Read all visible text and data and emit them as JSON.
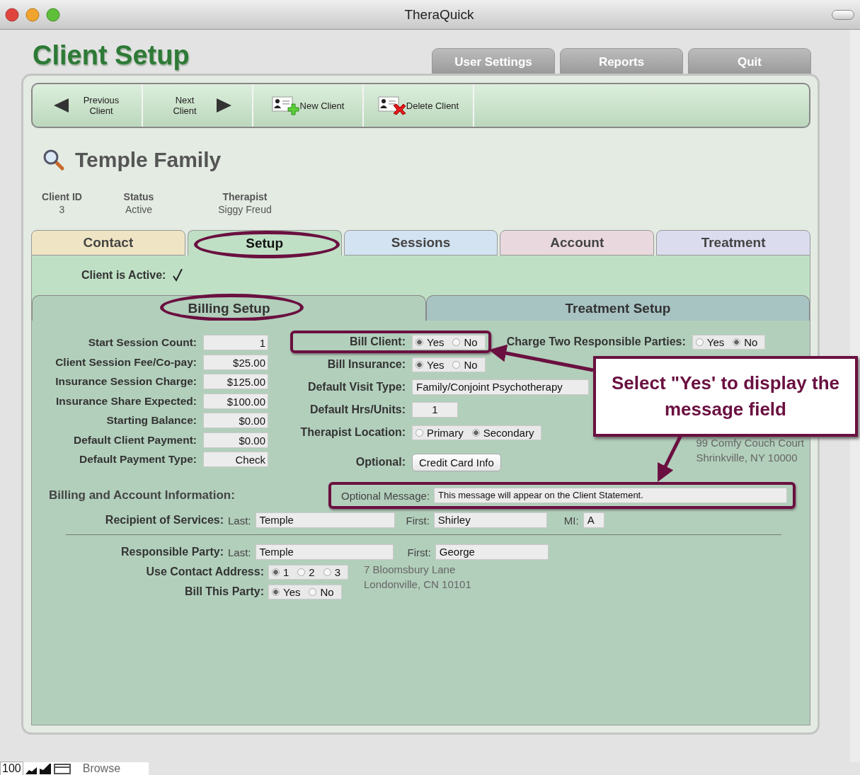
{
  "window": {
    "title": "TheraQuick"
  },
  "page_title": "Client Setup",
  "top_tabs": [
    {
      "label": "User Settings"
    },
    {
      "label": "Reports"
    },
    {
      "label": "Quit"
    }
  ],
  "toolbar": [
    {
      "kind": "prev",
      "label": "Previous Client"
    },
    {
      "kind": "next",
      "label": "Next Client"
    },
    {
      "kind": "new",
      "label": "New Client"
    },
    {
      "kind": "delete",
      "label": "Delete Client"
    }
  ],
  "client": {
    "name": "Temple Family",
    "fields": [
      {
        "label": "Client ID",
        "value": "3"
      },
      {
        "label": "Status",
        "value": "Active"
      },
      {
        "label": "Therapist",
        "value": "Siggy Freud"
      }
    ]
  },
  "tabs": [
    {
      "label": "Contact",
      "selected": false,
      "highlighted": false,
      "color": "#efe5c4"
    },
    {
      "label": "Setup",
      "selected": true,
      "highlighted": true,
      "color": "#bfe0c5"
    },
    {
      "label": "Sessions",
      "selected": false,
      "highlighted": false,
      "color": "#d3e3f1"
    },
    {
      "label": "Account",
      "selected": false,
      "highlighted": false,
      "color": "#e9d9de"
    },
    {
      "label": "Treatment",
      "selected": false,
      "highlighted": false,
      "color": "#dcdcef"
    }
  ],
  "client_active": {
    "label": "Client is Active:",
    "checked": true
  },
  "subtabs": [
    {
      "label": "Billing Setup",
      "selected": true,
      "highlighted": true
    },
    {
      "label": "Treatment Setup",
      "selected": false,
      "highlighted": false
    }
  ],
  "billing_fields": [
    {
      "label": "Start Session Count:",
      "value": "1"
    },
    {
      "label": "Client Session Fee/Co-pay:",
      "value": "$25.00"
    },
    {
      "label": "Insurance Session Charge:",
      "value": "$125.00"
    },
    {
      "label": "Insurance Share Expected:",
      "value": "$100.00"
    },
    {
      "label": "Starting Balance:",
      "value": "$0.00"
    },
    {
      "label": "Default Client Payment:",
      "value": "$0.00"
    },
    {
      "label": "Default Payment Type:",
      "value": "Check"
    }
  ],
  "right_fields": [
    {
      "kind": "radio",
      "label": "Bill Client:",
      "highlighted": true,
      "options": [
        {
          "label": "Yes",
          "selected": true
        },
        {
          "label": "No",
          "selected": false
        }
      ]
    },
    {
      "kind": "radio",
      "label": "Bill Insurance:",
      "highlighted": false,
      "options": [
        {
          "label": "Yes",
          "selected": true
        },
        {
          "label": "No",
          "selected": false
        }
      ]
    },
    {
      "kind": "text",
      "label": "Default Visit Type:",
      "highlighted": false,
      "value": "Family/Conjoint Psychotherapy"
    },
    {
      "kind": "short",
      "label": "Default Hrs/Units:",
      "highlighted": false,
      "value": "1"
    },
    {
      "kind": "radio",
      "label": "Therapist Location:",
      "highlighted": false,
      "options": [
        {
          "label": "Primary",
          "selected": false
        },
        {
          "label": "Secondary",
          "selected": true
        }
      ]
    },
    {
      "kind": "button",
      "label": "Optional:",
      "highlighted": false,
      "value": "Credit Card Info"
    }
  ],
  "charge_two": {
    "label": "Charge Two Responsible Parties:",
    "options": [
      {
        "label": "Yes",
        "selected": false
      },
      {
        "label": "No",
        "selected": true
      }
    ]
  },
  "address_1": [
    "99 Comfy Couch Court",
    "Shrinkville, NY 10000"
  ],
  "section_title": "Billing and Account Information:",
  "optional_message": {
    "label": "Optional Message:",
    "value": "This message will appear on the Client Statement.",
    "highlighted": true
  },
  "recipient": {
    "label": "Recipient of Services:",
    "last_label": "Last:",
    "last": "Temple",
    "first_label": "First:",
    "first": "Shirley",
    "mi_label": "MI:",
    "mi": "A"
  },
  "responsible": {
    "label": "Responsible Party:",
    "last_label": "Last:",
    "last": "Temple",
    "first_label": "First:",
    "first": "George"
  },
  "contact_address": {
    "label": "Use Contact Address:",
    "options": [
      {
        "label": "1",
        "selected": true
      },
      {
        "label": "2",
        "selected": false
      },
      {
        "label": "3",
        "selected": false
      }
    ]
  },
  "bill_party": {
    "label": "Bill This Party:",
    "options": [
      {
        "label": "Yes",
        "selected": true
      },
      {
        "label": "No",
        "selected": false
      }
    ]
  },
  "address_2": [
    "7 Bloomsbury Lane",
    "Londonville, CN 10101"
  ],
  "callout": {
    "text": "Select \"Yes' to display the message field"
  },
  "status_bar": {
    "zoom": "100",
    "mode": "Browse"
  }
}
